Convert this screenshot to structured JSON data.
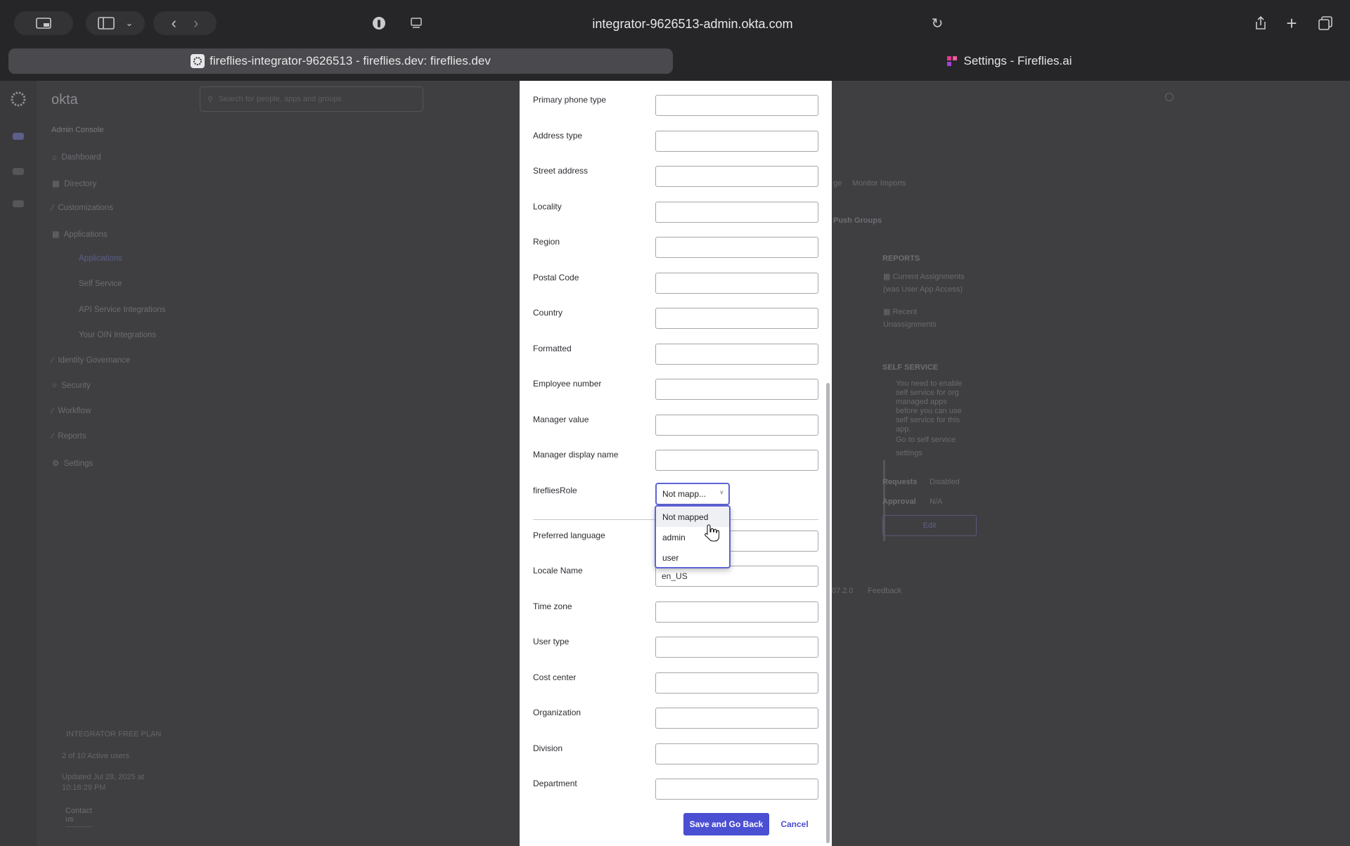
{
  "browser": {
    "url": "integrator-9626513-admin.okta.com",
    "tabs": [
      {
        "title": "fireflies-integrator-9626513 - fireflies.dev: fireflies.dev",
        "active": true
      },
      {
        "title": "Settings - Fireflies.ai",
        "active": false
      }
    ]
  },
  "okta": {
    "brand": "okta",
    "search_placeholder": "Search for people, apps and groups",
    "console_title": "Admin Console",
    "nav": [
      {
        "label": "Dashboard",
        "icon": "home-icon"
      },
      {
        "label": "Directory",
        "icon": "directory-icon"
      },
      {
        "label": "Customizations",
        "icon": "brush-icon"
      },
      {
        "label": "Applications",
        "icon": "grid-icon"
      },
      {
        "label": "Applications",
        "sub": true,
        "selected": true
      },
      {
        "label": "Self Service",
        "sub": true
      },
      {
        "label": "API Service Integrations",
        "sub": true
      },
      {
        "label": "Your OIN Integrations",
        "sub": true
      },
      {
        "label": "Identity Governance",
        "icon": "governance-icon"
      },
      {
        "label": "Security",
        "icon": "shield-icon"
      },
      {
        "label": "Workflow",
        "icon": "workflow-icon"
      },
      {
        "label": "Reports",
        "icon": "report-icon"
      },
      {
        "label": "Settings",
        "icon": "gear-icon"
      }
    ],
    "plan": {
      "title": "INTEGRATOR FREE PLAN",
      "users": "2 of 10 Active users",
      "updated_1": "Updated Jul 28, 2025 at",
      "updated_2": "10:18:29 PM",
      "contact": "Contact us"
    },
    "right": {
      "tab_text": "ge",
      "monitor": "Monitor Imports",
      "push_groups": "Push Groups",
      "reports_title": "REPORTS",
      "report_1a": "Current Assignments",
      "report_1b": "(was User App Access)",
      "report_2a": "Recent",
      "report_2b": "Unassignments",
      "self_service_title": "SELF SERVICE",
      "ss_lines": [
        "You need to enable",
        "self service for org",
        "managed apps",
        "before you can use",
        "self service for this",
        "app."
      ],
      "ss_link_1": "Go to self service",
      "ss_link_2": "settings",
      "requests_label": "Requests",
      "requests_value": "Disabled",
      "approval_label": "Approval",
      "approval_value": "N/A",
      "edit": "Edit",
      "footer_ver": "07.2.0",
      "footer_feedback": "Feedback"
    }
  },
  "modal": {
    "fields": [
      {
        "label": "Primary phone type",
        "value": ""
      },
      {
        "label": "Address type",
        "value": ""
      },
      {
        "label": "Street address",
        "value": ""
      },
      {
        "label": "Locality",
        "value": ""
      },
      {
        "label": "Region",
        "value": ""
      },
      {
        "label": "Postal Code",
        "value": ""
      },
      {
        "label": "Country",
        "value": ""
      },
      {
        "label": "Formatted",
        "value": ""
      },
      {
        "label": "Employee number",
        "value": ""
      },
      {
        "label": "Manager value",
        "value": ""
      },
      {
        "label": "Manager display name",
        "value": ""
      }
    ],
    "role": {
      "label": "firefliesRole",
      "selected": "Not mapp...",
      "options": [
        "Not mapped",
        "admin",
        "user"
      ],
      "hovered": "Not mapped"
    },
    "fields_after": [
      {
        "label": "Preferred language",
        "value": ""
      },
      {
        "label": "Locale Name",
        "value": "en_US"
      },
      {
        "label": "Time zone",
        "value": ""
      },
      {
        "label": "User type",
        "value": ""
      },
      {
        "label": "Cost center",
        "value": ""
      },
      {
        "label": "Organization",
        "value": ""
      },
      {
        "label": "Division",
        "value": ""
      },
      {
        "label": "Department",
        "value": ""
      }
    ],
    "save_label": "Save and Go Back",
    "cancel_label": "Cancel"
  },
  "colors": {
    "primary": "#4b4fd1",
    "focus": "#5e63d4"
  }
}
